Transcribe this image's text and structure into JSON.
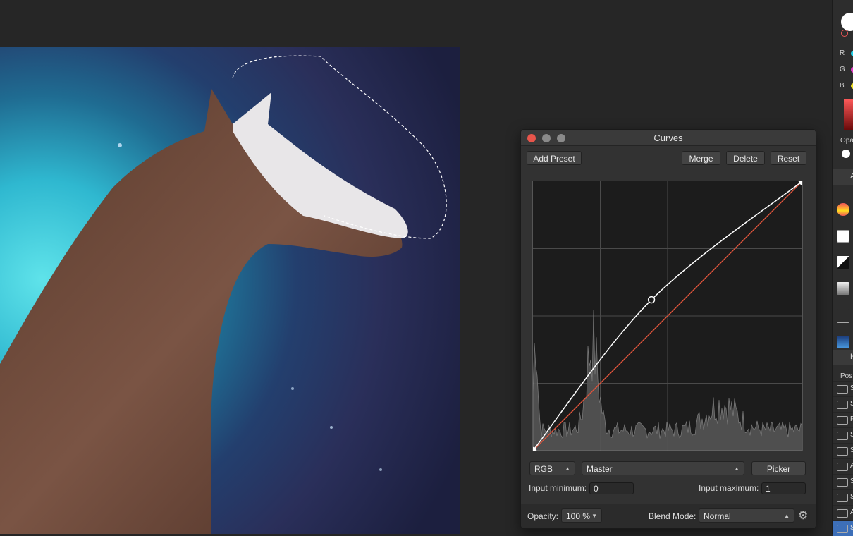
{
  "panel": {
    "title": "Curves",
    "buttons": {
      "add_preset": "Add Preset",
      "merge": "Merge",
      "delete": "Delete",
      "reset": "Reset",
      "picker": "Picker"
    },
    "channel_select": "RGB",
    "mode_select": "Master",
    "input_minimum_label": "Input minimum:",
    "input_minimum_value": "0",
    "input_maximum_label": "Input maximum:",
    "input_maximum_value": "1",
    "opacity_label": "Opacity:",
    "opacity_value": "100 %",
    "blend_mode_label": "Blend Mode:",
    "blend_mode_value": "Normal",
    "icons": {
      "close": "close-icon",
      "minimize": "minimize-icon",
      "zoom": "zoom-icon",
      "settings": "gear-icon"
    },
    "colors": {
      "curve": "#ffffff",
      "diagonal": "#e0543c",
      "close": "#e8554b",
      "traffic_inactive": "#8a8a8a"
    }
  },
  "curve_points": [
    {
      "input": 0,
      "output": 0
    },
    {
      "input": 0.44,
      "output": 0.56
    },
    {
      "input": 1,
      "output": 1
    }
  ],
  "right_panel": {
    "channels": [
      {
        "label": "R",
        "color": "#1fd0e8"
      },
      {
        "label": "G",
        "color": "#e43cc8"
      },
      {
        "label": "B",
        "color": "#f0e020"
      }
    ],
    "opacity_label": "Opa",
    "tab_label": "A",
    "tab2_label": "H",
    "pos_label": "Pos",
    "layers": [
      "S",
      "S",
      "P",
      "S",
      "S",
      "A",
      "S",
      "S",
      "A",
      "S"
    ]
  }
}
